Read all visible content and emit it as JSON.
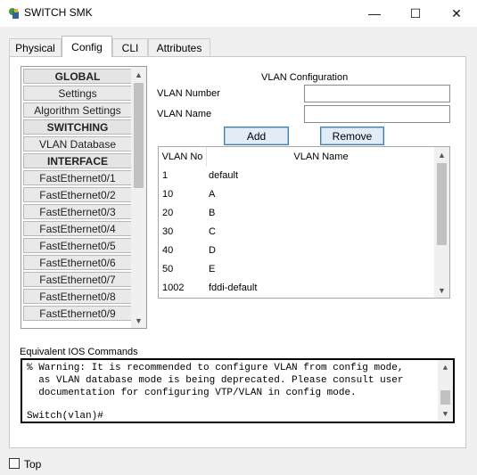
{
  "window": {
    "title": "SWITCH SMK",
    "minimize": "—",
    "maximize": "☐",
    "close": "✕"
  },
  "tabs": [
    "Physical",
    "Config",
    "CLI",
    "Attributes"
  ],
  "nav": {
    "items": [
      {
        "label": "GLOBAL",
        "header": true
      },
      {
        "label": "Settings",
        "header": false
      },
      {
        "label": "Algorithm Settings",
        "header": false
      },
      {
        "label": "SWITCHING",
        "header": true
      },
      {
        "label": "VLAN Database",
        "header": false
      },
      {
        "label": "INTERFACE",
        "header": true
      },
      {
        "label": "FastEthernet0/1",
        "header": false
      },
      {
        "label": "FastEthernet0/2",
        "header": false
      },
      {
        "label": "FastEthernet0/3",
        "header": false
      },
      {
        "label": "FastEthernet0/4",
        "header": false
      },
      {
        "label": "FastEthernet0/5",
        "header": false
      },
      {
        "label": "FastEthernet0/6",
        "header": false
      },
      {
        "label": "FastEthernet0/7",
        "header": false
      },
      {
        "label": "FastEthernet0/8",
        "header": false
      },
      {
        "label": "FastEthernet0/9",
        "header": false
      }
    ]
  },
  "vlan_config": {
    "title": "VLAN Configuration",
    "number_label": "VLAN Number",
    "name_label": "VLAN Name",
    "number_value": "",
    "name_value": "",
    "add_label": "Add",
    "remove_label": "Remove",
    "table_headers": [
      "VLAN No",
      "VLAN Name"
    ],
    "rows": [
      {
        "no": "1",
        "name": "default"
      },
      {
        "no": "10",
        "name": "A"
      },
      {
        "no": "20",
        "name": "B"
      },
      {
        "no": "30",
        "name": "C"
      },
      {
        "no": "40",
        "name": "D"
      },
      {
        "no": "50",
        "name": "E"
      },
      {
        "no": "1002",
        "name": "fddi-default"
      }
    ]
  },
  "ios": {
    "label": "Equivalent IOS Commands",
    "text": "% Warning: It is recommended to configure VLAN from config mode,\n  as VLAN database mode is being deprecated. Please consult user\n  documentation for configuring VTP/VLAN in config mode.",
    "prompt": "Switch(vlan)#"
  },
  "footer": {
    "top_label": "Top",
    "top_checked": false
  }
}
